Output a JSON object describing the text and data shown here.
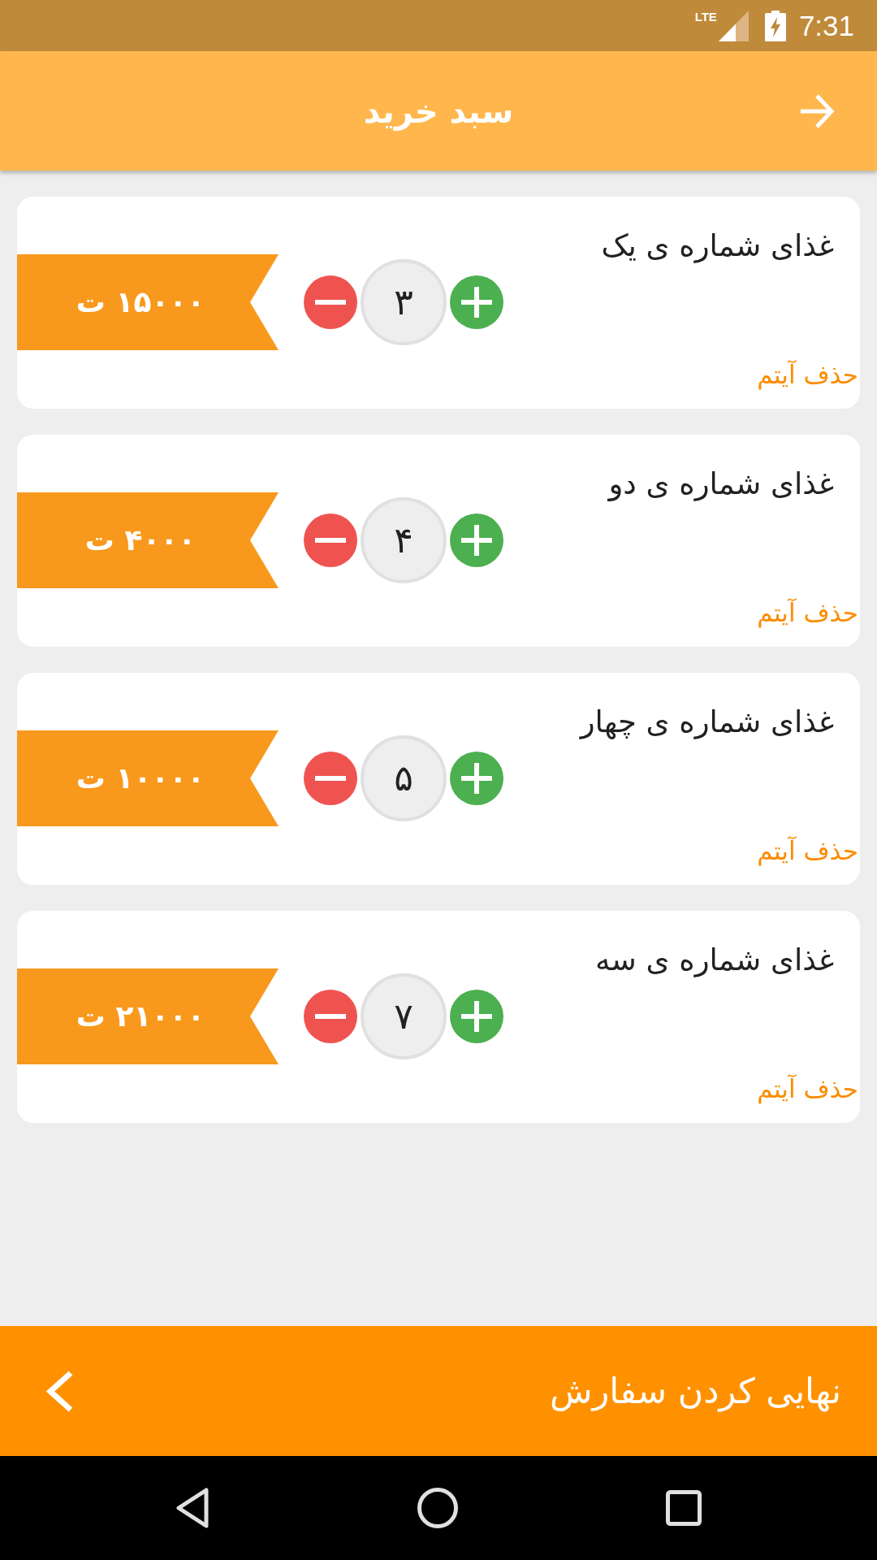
{
  "status_bar": {
    "network": "LTE",
    "time": "7:31"
  },
  "app_bar": {
    "title": "سبد خرید"
  },
  "cart_items": [
    {
      "name": "غذای شماره ی یک",
      "quantity": "۳",
      "price": "۱۵۰۰۰ ت",
      "remove_label": "حذف آیتم"
    },
    {
      "name": "غذای شماره ی دو",
      "quantity": "۴",
      "price": "۴۰۰۰ ت",
      "remove_label": "حذف آیتم"
    },
    {
      "name": "غذای شماره ی چهار",
      "quantity": "۵",
      "price": "۱۰۰۰۰ ت",
      "remove_label": "حذف آیتم"
    },
    {
      "name": "غذای شماره ی سه",
      "quantity": "۷",
      "price": "۲۱۰۰۰ ت",
      "remove_label": "حذف آیتم"
    }
  ],
  "checkout_bar": {
    "label": "نهایی کردن سفارش"
  }
}
